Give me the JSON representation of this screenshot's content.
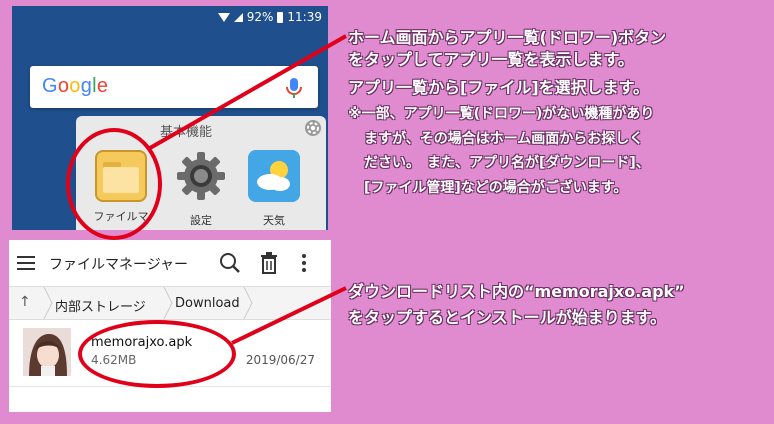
{
  "status_bar": {
    "battery": "92%",
    "time": "11:39"
  },
  "home": {
    "folder_title": "基本機能",
    "apps": [
      {
        "label": "ファイルマ"
      },
      {
        "label": "設定"
      },
      {
        "label": "天気"
      }
    ]
  },
  "files_app": {
    "title": "ファイルマネージャー",
    "breadcrumb": [
      "内部ストレージ",
      "Download"
    ],
    "file": {
      "name": "memorajxo.apk",
      "size": "4.62MB",
      "date": "2019/06/27"
    }
  },
  "annotations": {
    "note1": [
      "ホーム画面からアプリ一覧(ドロワー)ボタン",
      "をタップしてアプリ一覧を表示します。",
      "アプリ一覧から[ファイル]を選択します。",
      "※一部、アプリ一覧(ドロワー)がない機種があり",
      "ますが、その場合はホーム画面からお探しく",
      "ださい。　また、アプリ名が[ダウンロード]、",
      "[ファイル管理]などの場合がございます。"
    ],
    "note2": [
      "ダウンロードリスト内の“memorajxo.apk”",
      "をタップするとインストールが始まります。"
    ]
  },
  "colors": {
    "background": "#e08bd0",
    "highlight": "#e0001a",
    "home_bg": "#1f4f8d"
  },
  "icons": [
    "wifi-icon",
    "signal-icon",
    "battery-icon",
    "mic-icon",
    "gear-icon",
    "folder-icon",
    "settings-icon",
    "weather-icon",
    "hamburger-icon",
    "search-icon",
    "trash-icon",
    "more-icon",
    "up-arrow-icon"
  ]
}
